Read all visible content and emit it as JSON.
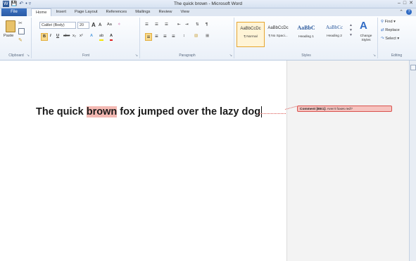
{
  "window": {
    "title": "The quick brown - Microsoft Word"
  },
  "qat": {
    "word_icon": "W",
    "save": "💾",
    "undo": "↶",
    "dropdown": "• ▿"
  },
  "window_controls": {
    "minimize": "–",
    "restore": "□",
    "close": "✕"
  },
  "tabs": {
    "file": "File",
    "items": [
      "Home",
      "Insert",
      "Page Layout",
      "References",
      "Mailings",
      "Review",
      "View"
    ],
    "active": "Home"
  },
  "ribbon": {
    "clipboard": {
      "paste": "Paste",
      "label": "Clipboard"
    },
    "font": {
      "name": "Calibri (Body)",
      "size": "20",
      "grow": "A",
      "shrink": "A",
      "case": "Aa",
      "clear": "✧",
      "bold": "B",
      "italic": "I",
      "underline": "U",
      "strike": "abe",
      "subscript": "x₂",
      "superscript": "x²",
      "effects": "A",
      "highlight": "ab",
      "color": "A",
      "label": "Font"
    },
    "paragraph": {
      "bullets": "☰",
      "numbering": "☰",
      "multilevel": "☰",
      "decrease": "⇤",
      "increase": "⇥",
      "sort": "⇅",
      "show": "¶",
      "align_left": "≡",
      "center": "≡",
      "align_right": "≡",
      "justify": "≡",
      "spacing": "↕",
      "shading": "▧",
      "border": "▦",
      "label": "Paragraph"
    },
    "styles": {
      "items": [
        {
          "preview": "AaBbCcDc",
          "name": "¶ Normal",
          "selected": true
        },
        {
          "preview": "AaBbCcDc",
          "name": "¶ No Spaci...",
          "selected": false
        },
        {
          "preview": "AaBbC",
          "name": "Heading 1",
          "selected": false
        },
        {
          "preview": "AaBbCc",
          "name": "Heading 2",
          "selected": false
        }
      ],
      "change_styles": "Change Styles",
      "label": "Styles"
    },
    "editing": {
      "find": "Find",
      "replace": "Replace",
      "select": "Select",
      "label": "Editing"
    }
  },
  "document": {
    "before": "The quick ",
    "highlighted": "brown",
    "after": " fox jumped over the lazy dog"
  },
  "comment": {
    "tag": "Comment [BE1]:",
    "text": "Aren't foxes red?"
  },
  "colors": {
    "file_tab": "#2a5aa5",
    "comment_fill": "#f6c3bf",
    "comment_border": "#d9534f",
    "highlight": "#f4b9b3"
  }
}
